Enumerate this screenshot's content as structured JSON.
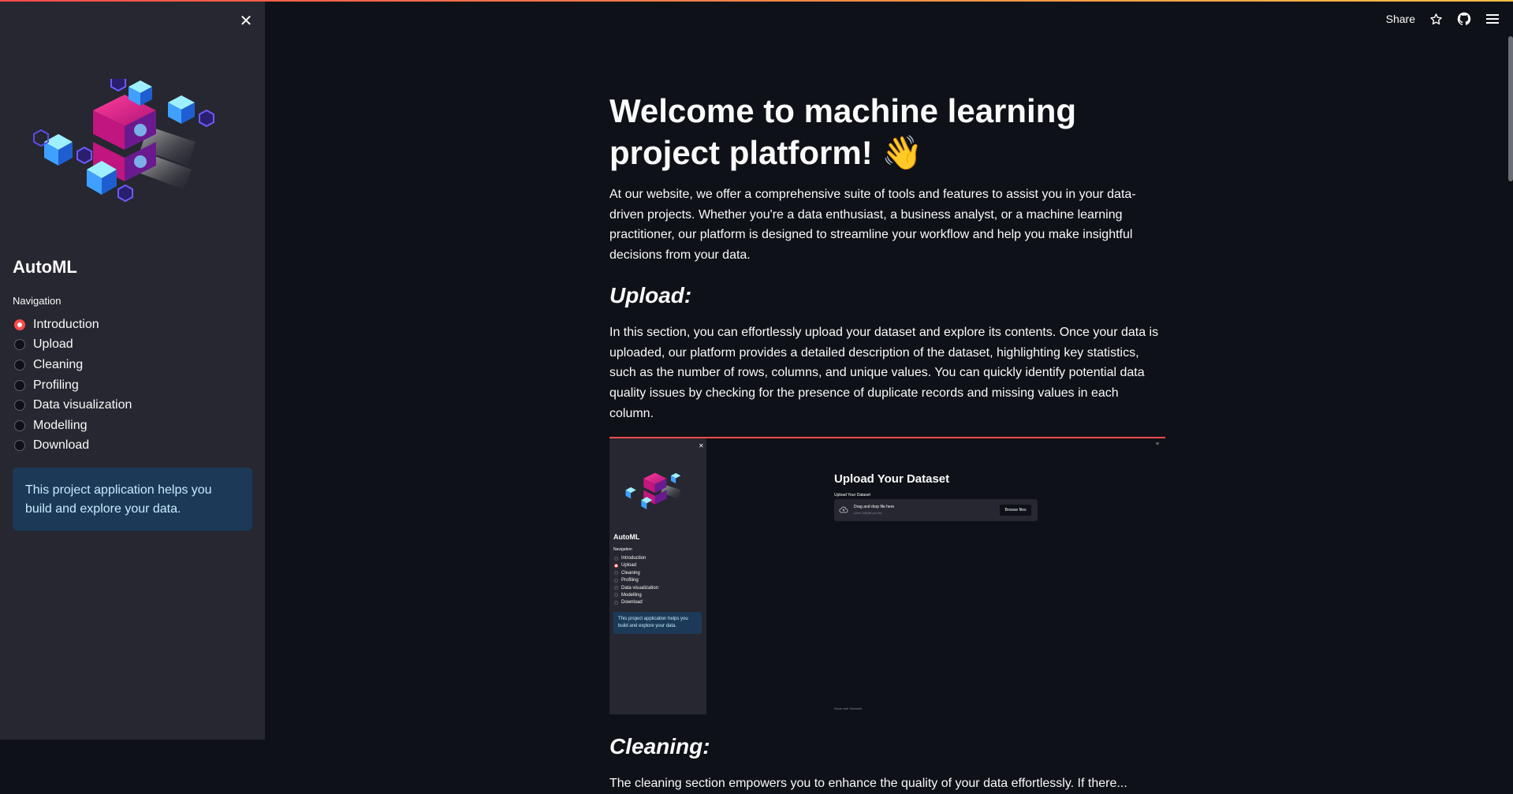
{
  "header": {
    "share_label": "Share",
    "icons": [
      "star-icon",
      "github-icon",
      "hamburger-menu-icon"
    ]
  },
  "sidebar": {
    "brand": "AutoML",
    "nav_label": "Navigation",
    "items": [
      {
        "label": "Introduction",
        "selected": true
      },
      {
        "label": "Upload",
        "selected": false
      },
      {
        "label": "Cleaning",
        "selected": false
      },
      {
        "label": "Profiling",
        "selected": false
      },
      {
        "label": "Data visualization",
        "selected": false
      },
      {
        "label": "Modelling",
        "selected": false
      },
      {
        "label": "Download",
        "selected": false
      }
    ],
    "info": "This project application helps you build and explore your data."
  },
  "main": {
    "title": "Welcome to machine learning project platform! 👋",
    "intro": "At our website, we offer a comprehensive suite of tools and features to assist you in your data-driven projects. Whether you're a data enthusiast, a business analyst, or a machine learning practitioner, our platform is designed to streamline your workflow and help you make insightful decisions from your data.",
    "upload_heading": "Upload:",
    "upload_text": "In this section, you can effortlessly upload your dataset and explore its contents. Once your data is uploaded, our platform provides a detailed description of the dataset, highlighting key statistics, such as the number of rows, columns, and unique values. You can quickly identify potential data quality issues by checking for the presence of duplicate records and missing values in each column.",
    "cleaning_heading": "Cleaning:",
    "cleaning_text": "The cleaning section empowers you to enhance the quality of your data effortlessly. If there..."
  },
  "preview": {
    "brand": "AutoML",
    "nav_label": "Navigation",
    "items": [
      "Introduction",
      "Upload",
      "Cleaning",
      "Profiling",
      "Data visualization",
      "Modelling",
      "Download"
    ],
    "selected_index": 1,
    "info": "This project application helps you build and explore your data.",
    "title": "Upload Your Dataset",
    "upload_label": "Upload Your Dataset",
    "dropzone_text": "Drag and drop file here",
    "dropzone_limit": "Limit 200MB per file",
    "browse_label": "Browse files",
    "made_with": "Made with Streamlit"
  }
}
